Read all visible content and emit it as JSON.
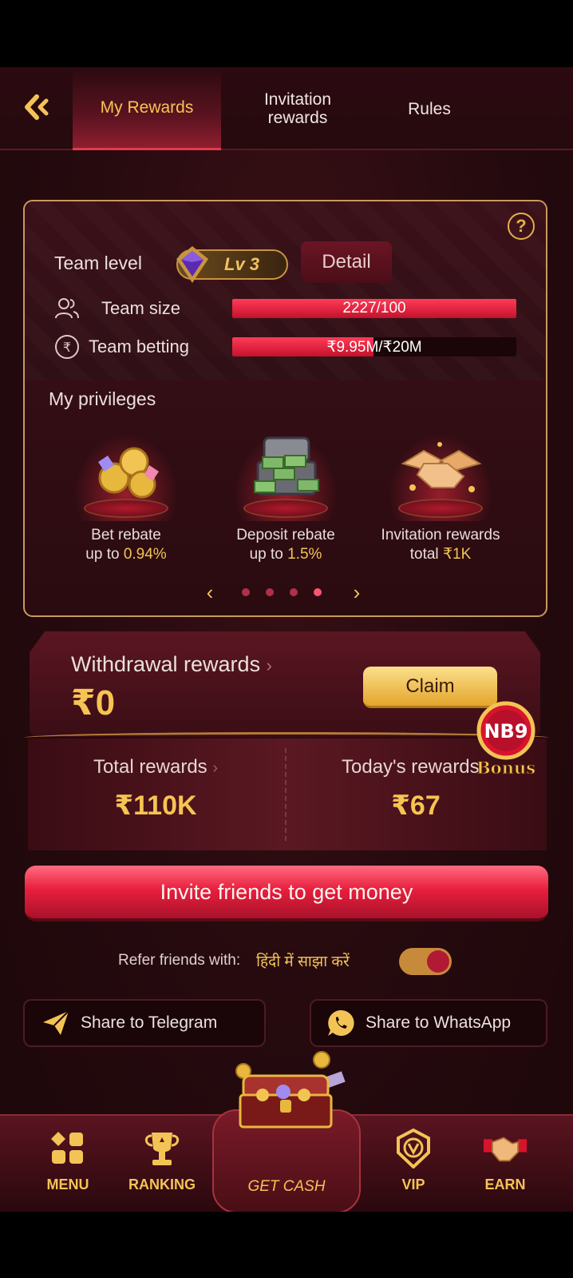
{
  "header": {
    "tabs": [
      {
        "label": "My Rewards",
        "active": true
      },
      {
        "label": "Invitation\nrewards",
        "active": false
      },
      {
        "label": "Rules",
        "active": false
      }
    ]
  },
  "team": {
    "level_label": "Team level",
    "level_badge": "Lv 3",
    "detail_label": "Detail",
    "size_label": "Team size",
    "size_value": "2227/100",
    "size_progress": 1.0,
    "betting_label": "Team betting",
    "betting_value": "₹9.95M/₹20M",
    "betting_progress": 0.4975
  },
  "privileges": {
    "title": "My privileges",
    "items": [
      {
        "line1": "Bet rebate",
        "line2_prefix": "up to ",
        "line2_value": "0.94%",
        "icon": "coins-gems-icon"
      },
      {
        "line1": "Deposit rebate",
        "line2_prefix": "up to ",
        "line2_value": "1.5%",
        "icon": "cash-chest-icon"
      },
      {
        "line1": "Invitation rewards",
        "line2_prefix": "total ",
        "line2_value": "₹1K",
        "icon": "handshake-icon"
      }
    ],
    "pages": 4,
    "active_page": 4
  },
  "withdrawal": {
    "title": "Withdrawal rewards",
    "amount": "₹0",
    "claim_label": "Claim"
  },
  "rewards": {
    "total_label": "Total rewards",
    "total_value": "₹110K",
    "today_label": "Today's rewards",
    "today_value": "₹67"
  },
  "bonus_badge": {
    "brand": "NB9",
    "label": "Bonus"
  },
  "invite_label": "Invite friends to get money",
  "refer": {
    "label": "Refer friends with:",
    "language": "हिंदी में साझा करें",
    "toggle_on": true
  },
  "share": {
    "telegram": "Share to Telegram",
    "whatsapp": "Share to WhatsApp"
  },
  "nav": {
    "menu": "MENU",
    "ranking": "RANKING",
    "get_cash": "GET CASH",
    "vip": "VIP",
    "earn": "EARN"
  },
  "colors": {
    "gold": "#f6c452",
    "accent_red": "#e81f3d",
    "background": "#250a0e"
  }
}
